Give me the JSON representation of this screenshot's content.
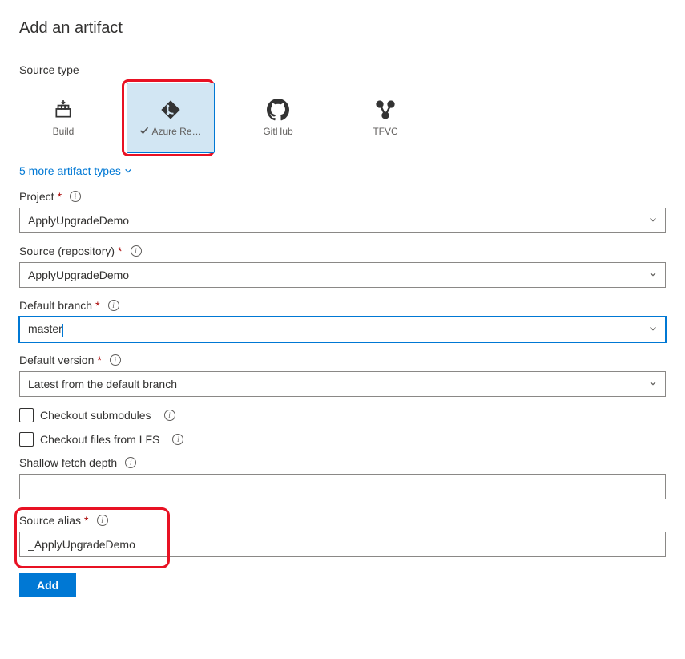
{
  "title": "Add an artifact",
  "source_type": {
    "label": "Source type",
    "tiles": [
      {
        "label": "Build",
        "selected": false
      },
      {
        "label": "Azure Re…",
        "selected": true
      },
      {
        "label": "GitHub",
        "selected": false
      },
      {
        "label": "TFVC",
        "selected": false
      }
    ],
    "more_link": "5 more artifact types"
  },
  "fields": {
    "project": {
      "label": "Project",
      "value": "ApplyUpgradeDemo"
    },
    "source_repo": {
      "label": "Source (repository)",
      "value": "ApplyUpgradeDemo"
    },
    "default_branch": {
      "label": "Default branch",
      "value": "master"
    },
    "default_version": {
      "label": "Default version",
      "value": "Latest from the default branch"
    },
    "checkout_submodules": {
      "label": "Checkout submodules"
    },
    "checkout_lfs": {
      "label": "Checkout files from LFS"
    },
    "shallow_depth": {
      "label": "Shallow fetch depth",
      "value": ""
    },
    "source_alias": {
      "label": "Source alias",
      "value": "_ApplyUpgradeDemo"
    }
  },
  "add_button": "Add"
}
